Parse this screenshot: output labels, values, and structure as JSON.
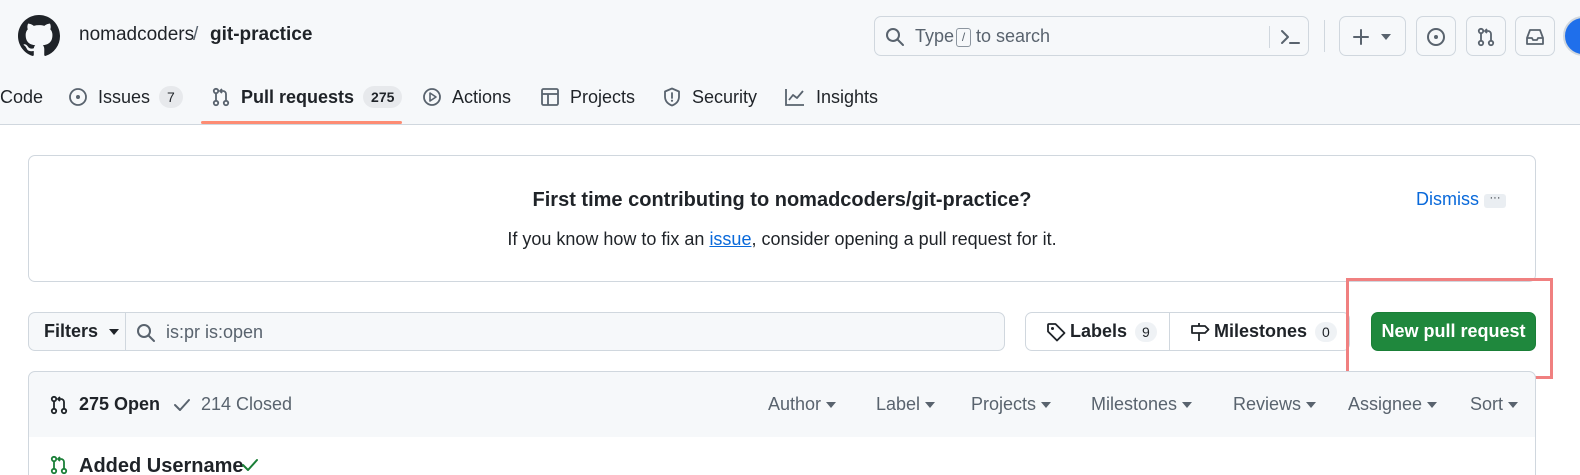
{
  "header": {
    "owner": "nomadcoders",
    "separator": "/",
    "repo": "git-practice",
    "search": {
      "prefix": "Type",
      "key": "/",
      "suffix": "to search"
    }
  },
  "tabs": [
    {
      "label": "Code"
    },
    {
      "label": "Issues",
      "count": "7"
    },
    {
      "label": "Pull requests",
      "count": "275"
    },
    {
      "label": "Actions"
    },
    {
      "label": "Projects"
    },
    {
      "label": "Security"
    },
    {
      "label": "Insights"
    }
  ],
  "banner": {
    "title": "First time contributing to nomadcoders/git-practice?",
    "body_pre": "If you know how to fix an ",
    "body_link": "issue",
    "body_post": ", consider opening a pull request for it.",
    "dismiss": "Dismiss",
    "more": "···"
  },
  "filter_bar": {
    "filters_label": "Filters",
    "query": "is:pr is:open",
    "labels_label": "Labels",
    "labels_count": "9",
    "milestones_label": "Milestones",
    "milestones_count": "0",
    "new_pr_label": "New pull request"
  },
  "list": {
    "open_label": "275 Open",
    "closed_label": "214 Closed",
    "sort_options": [
      "Author",
      "Label",
      "Projects",
      "Milestones",
      "Reviews",
      "Assignee",
      "Sort"
    ],
    "rows": [
      {
        "title": "Added Username",
        "status_icon": "check-icon"
      }
    ]
  },
  "colors": {
    "primary_button": "#1f883d",
    "tab_underline": "#fd8c73",
    "link": "#0969da",
    "highlight_box": "#f08080"
  }
}
